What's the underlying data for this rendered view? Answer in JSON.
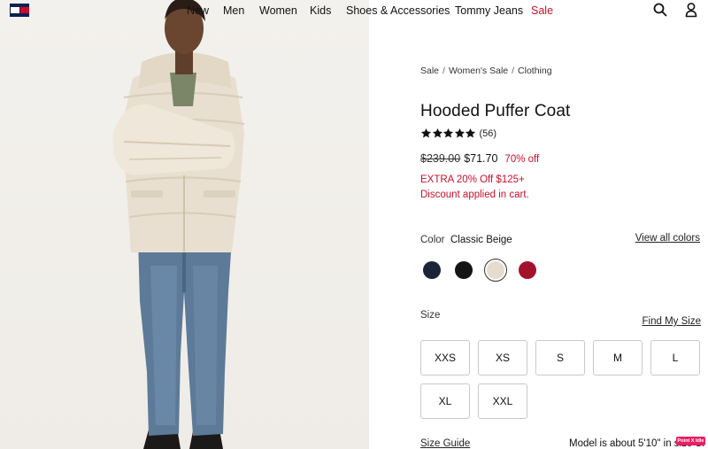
{
  "header": {
    "logo_icon": "tommy-hilfiger-flag-logo",
    "nav": [
      {
        "label": "New",
        "highlight": false
      },
      {
        "label": "Men",
        "highlight": false
      },
      {
        "label": "Women",
        "highlight": false
      },
      {
        "label": "Kids",
        "highlight": false
      },
      {
        "label": "Shoes & Accessories",
        "highlight": false
      },
      {
        "label": "Tommy Jeans",
        "highlight": false
      },
      {
        "label": "Sale",
        "highlight": true
      }
    ],
    "icons": [
      "search-icon",
      "account-icon"
    ]
  },
  "breadcrumb": [
    "Sale",
    "Women's Sale",
    "Clothing"
  ],
  "product": {
    "title": "Hooded Puffer Coat",
    "rating": 5,
    "rating_max": 5,
    "review_count": "(56)",
    "original_price": "$239.00",
    "sale_price": "$71.70",
    "discount": "70% off",
    "promo_line1": "EXTRA 20% Off $125+",
    "promo_line2": "Discount applied in cart."
  },
  "color": {
    "label": "Color",
    "selected": "Classic Beige",
    "view_all": "View all colors",
    "swatches": [
      {
        "name": "navy",
        "hex": "#1b2438",
        "selected": false
      },
      {
        "name": "black",
        "hex": "#141414",
        "selected": false
      },
      {
        "name": "classic-beige",
        "hex": "#e6dccd",
        "selected": true
      },
      {
        "name": "red",
        "hex": "#a3122d",
        "selected": false
      }
    ]
  },
  "size": {
    "label": "Size",
    "find_my_size": "Find My Size",
    "options": [
      "XXS",
      "XS",
      "S",
      "M",
      "L",
      "XL",
      "XXL"
    ],
    "size_guide": "Size Guide",
    "model_note": "Model is about 5'10\" in size S."
  },
  "feedback_badge": "Point X Idle",
  "colors": {
    "sale_red": "#c8102e",
    "text": "#111111",
    "border": "#c9c9c9"
  }
}
